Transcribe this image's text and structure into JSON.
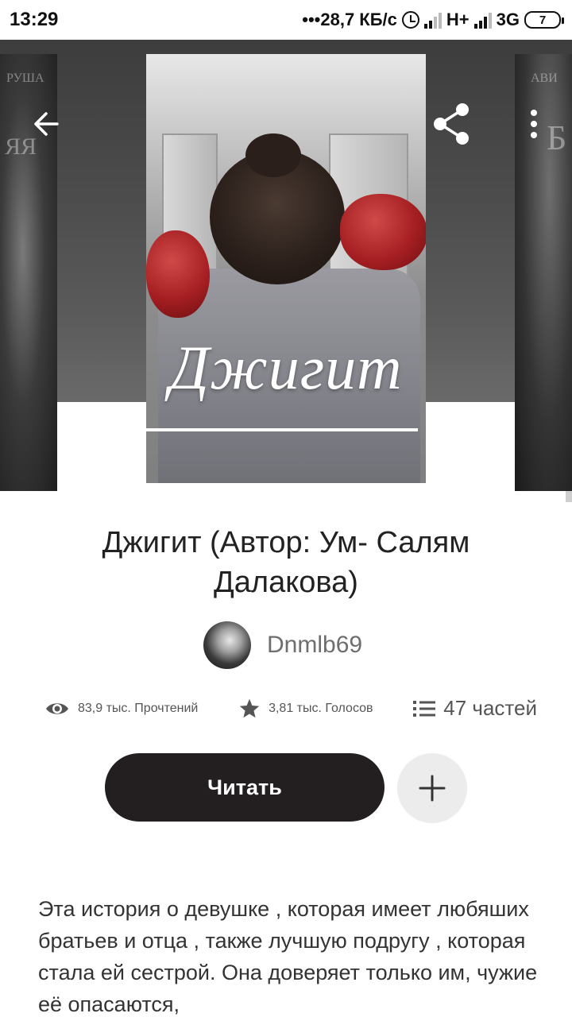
{
  "status_bar": {
    "time": "13:29",
    "network_speed": "•••28,7 КБ/с",
    "network_1": "H+",
    "network_2": "3G",
    "battery": "7"
  },
  "hero": {
    "cover_title": "Джигит",
    "left_cover_text_1": "РУША",
    "left_cover_text_2": "ЯЯ",
    "right_cover_text_1": "АВИ",
    "right_cover_text_2": "Б"
  },
  "book": {
    "title": "Джигит (Автор: Ум- Салям Далакова)",
    "author": "Dnmlb69"
  },
  "stats": {
    "reads": "83,9 тыс. Прочтений",
    "votes": "3,81 тыс. Голосов",
    "parts": "47 частей"
  },
  "actions": {
    "read_label": "Читать"
  },
  "description": "Эта история о девушке , которая имеет любяших братьев и отца , также лучшую подругу , которая стала ей сестрой. Она доверяет только им, чужие её опасаются,",
  "icons": {
    "back": "arrow-left-icon",
    "share": "share-icon",
    "more": "more-vertical-icon",
    "views": "eye-icon",
    "votes": "star-icon",
    "parts": "list-icon",
    "add": "plus-icon"
  },
  "colors": {
    "read_button": "#231f20",
    "add_button": "#ececec",
    "hero_bg": "#4a4a4a"
  }
}
